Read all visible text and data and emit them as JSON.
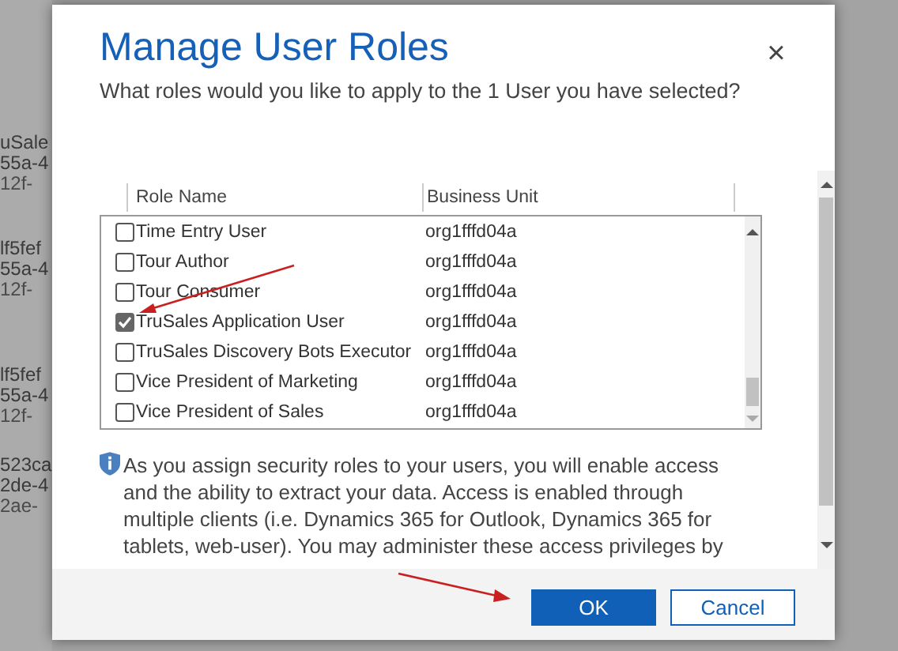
{
  "background_fragments": [
    {
      "lines": [
        "uSale",
        "55a-4",
        "12f-"
      ]
    },
    {
      "lines": [
        "lf5fef",
        "55a-4",
        "12f-"
      ]
    },
    {
      "lines": [
        "lf5fef",
        "55a-4",
        "12f-"
      ]
    },
    {
      "lines": [
        "523ca",
        "2de-4",
        "2ae-"
      ]
    }
  ],
  "dialog": {
    "title": "Manage User Roles",
    "subtitle": "What roles would you like to apply to the 1 User you have selected?",
    "close": "×",
    "table": {
      "columns": [
        "Role Name",
        "Business Unit"
      ],
      "rows": [
        {
          "role": "Time Entry User",
          "business_unit": "org1fffd04a",
          "checked": false
        },
        {
          "role": "Tour Author",
          "business_unit": "org1fffd04a",
          "checked": false
        },
        {
          "role": "Tour Consumer",
          "business_unit": "org1fffd04a",
          "checked": false
        },
        {
          "role": "TruSales Application User",
          "business_unit": "org1fffd04a",
          "checked": true
        },
        {
          "role": "TruSales Discovery Bots Executor",
          "business_unit": "org1fffd04a",
          "checked": false
        },
        {
          "role": "Vice President of Marketing",
          "business_unit": "org1fffd04a",
          "checked": false
        },
        {
          "role": "Vice President of Sales",
          "business_unit": "org1fffd04a",
          "checked": false
        }
      ]
    },
    "info": {
      "lines": [
        "As you assign security roles to your users, you will enable access",
        "and the ability to extract your data. Access is enabled through",
        "multiple clients (i.e. Dynamics 365 for Outlook, Dynamics 365 for",
        "tablets, web-user). You may administer these access privileges by"
      ]
    },
    "buttons": [
      {
        "label": "OK",
        "kind": "primary"
      },
      {
        "label": "Cancel",
        "kind": "secondary"
      }
    ]
  }
}
